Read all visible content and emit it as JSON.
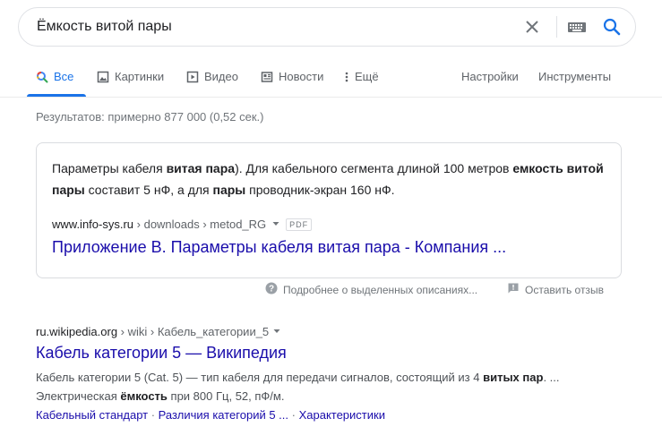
{
  "search": {
    "query": "Ёмкость витой пары"
  },
  "tabs": [
    {
      "label": "Все",
      "icon": "search-icon"
    },
    {
      "label": "Картинки",
      "icon": "image-icon"
    },
    {
      "label": "Видео",
      "icon": "video-icon"
    },
    {
      "label": "Новости",
      "icon": "news-icon"
    },
    {
      "label": "Ещё",
      "icon": "more-vert-icon"
    }
  ],
  "tools": {
    "settings": "Настройки",
    "tools": "Инструменты"
  },
  "stats": "Результатов: примерно 877 000 (0,52 сек.)",
  "featured": {
    "t1": "Параметры кабеля ",
    "b1": "витая пара",
    "t2": "). Для кабельного сегмента длиной 100 метров ",
    "b2": "емкость витой пары",
    "t3": " составит 5 нФ, а для ",
    "b3": "пары",
    "t4": " проводник-экран 160 нФ.",
    "domain": "www.info-sys.ru",
    "path": " › downloads › metod_RG",
    "badge": "PDF",
    "title": "Приложение В. Параметры кабеля витая пара - Компания ..."
  },
  "feedback": {
    "about": "Подробнее о выделенных описаниях...",
    "report": "Оставить отзыв"
  },
  "result": {
    "domain": "ru.wikipedia.org",
    "path": " › wiki › Кабель_категории_5",
    "title": "Кабель категории 5 — Википедия",
    "s1": "Кабель категории 5 (Cat. 5) — тип кабеля для передачи сигналов, состоящий из 4 ",
    "b1": "витых пар",
    "s2": ". ... Электрическая ",
    "b2": "ёмкость",
    "s3": " при 800 Гц, 52, пФ/м.",
    "links": [
      "Кабельный стандарт",
      "Различия категорий 5 ...",
      "Характеристики"
    ],
    "sep": " · "
  },
  "colors": {
    "link": "#1a0dab",
    "accent": "#1a73e8"
  }
}
